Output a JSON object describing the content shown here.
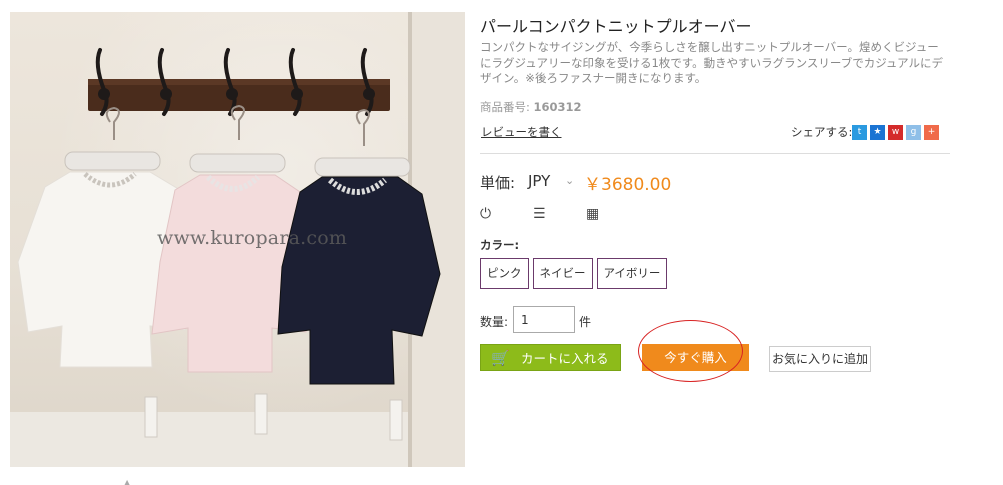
{
  "product": {
    "title": "パールコンパクトニットプルオーバー",
    "description": "コンパクトなサイジングが、今季らしさを醸し出すニットプルオーバー。煌めくビジューにラグジュアリーな印象を受ける1枚です。動きやすいラグランスリーブでカジュアルにデザイン。※後ろファスナー開きになります。",
    "sku_label": "商品番号:",
    "sku": "160312",
    "review_link": "レビューを書く",
    "watermark": "www.kuropara.com",
    "share_label": "シェアする:",
    "share_icons": [
      "twitter-icon",
      "star-icon",
      "weibo-icon",
      "plus-icon",
      "add-icon"
    ]
  },
  "price": {
    "label": "単価:",
    "currency": "JPY",
    "amount": "￥3680.00"
  },
  "tools": [
    "power-icon",
    "list-icon",
    "calendar-icon"
  ],
  "color": {
    "label": "カラー:",
    "options": [
      "ピンク",
      "ネイビー",
      "アイボリー"
    ]
  },
  "quantity": {
    "label": "数量:",
    "value": "1",
    "unit": "件"
  },
  "buttons": {
    "cart": "カートに入れる",
    "buy_now": "今すぐ購入",
    "favorite": "お気に入りに追加"
  },
  "colors": {
    "accent": "#f08a1c",
    "cart": "#8dbb1a",
    "highlight": "#d82323",
    "option_border": "#6b3a6b"
  }
}
